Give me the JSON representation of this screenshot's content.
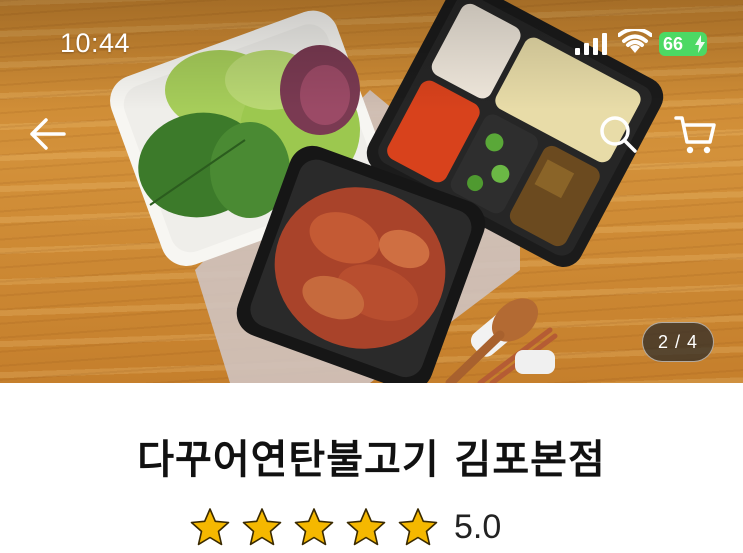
{
  "status_bar": {
    "time": "10:44",
    "battery_level": "66",
    "battery_color": "#4cd964"
  },
  "gallery": {
    "counter": "2 / 4",
    "current_index": 2,
    "total": 4
  },
  "nav": {
    "back_icon": "arrow-left-icon",
    "search_icon": "search-icon",
    "cart_icon": "cart-icon"
  },
  "store": {
    "name": "다꾸어연탄불고기 김포본점",
    "rating": "5.0",
    "stars_filled": 5,
    "stars_total": 5,
    "star_color": "#f5b800"
  }
}
